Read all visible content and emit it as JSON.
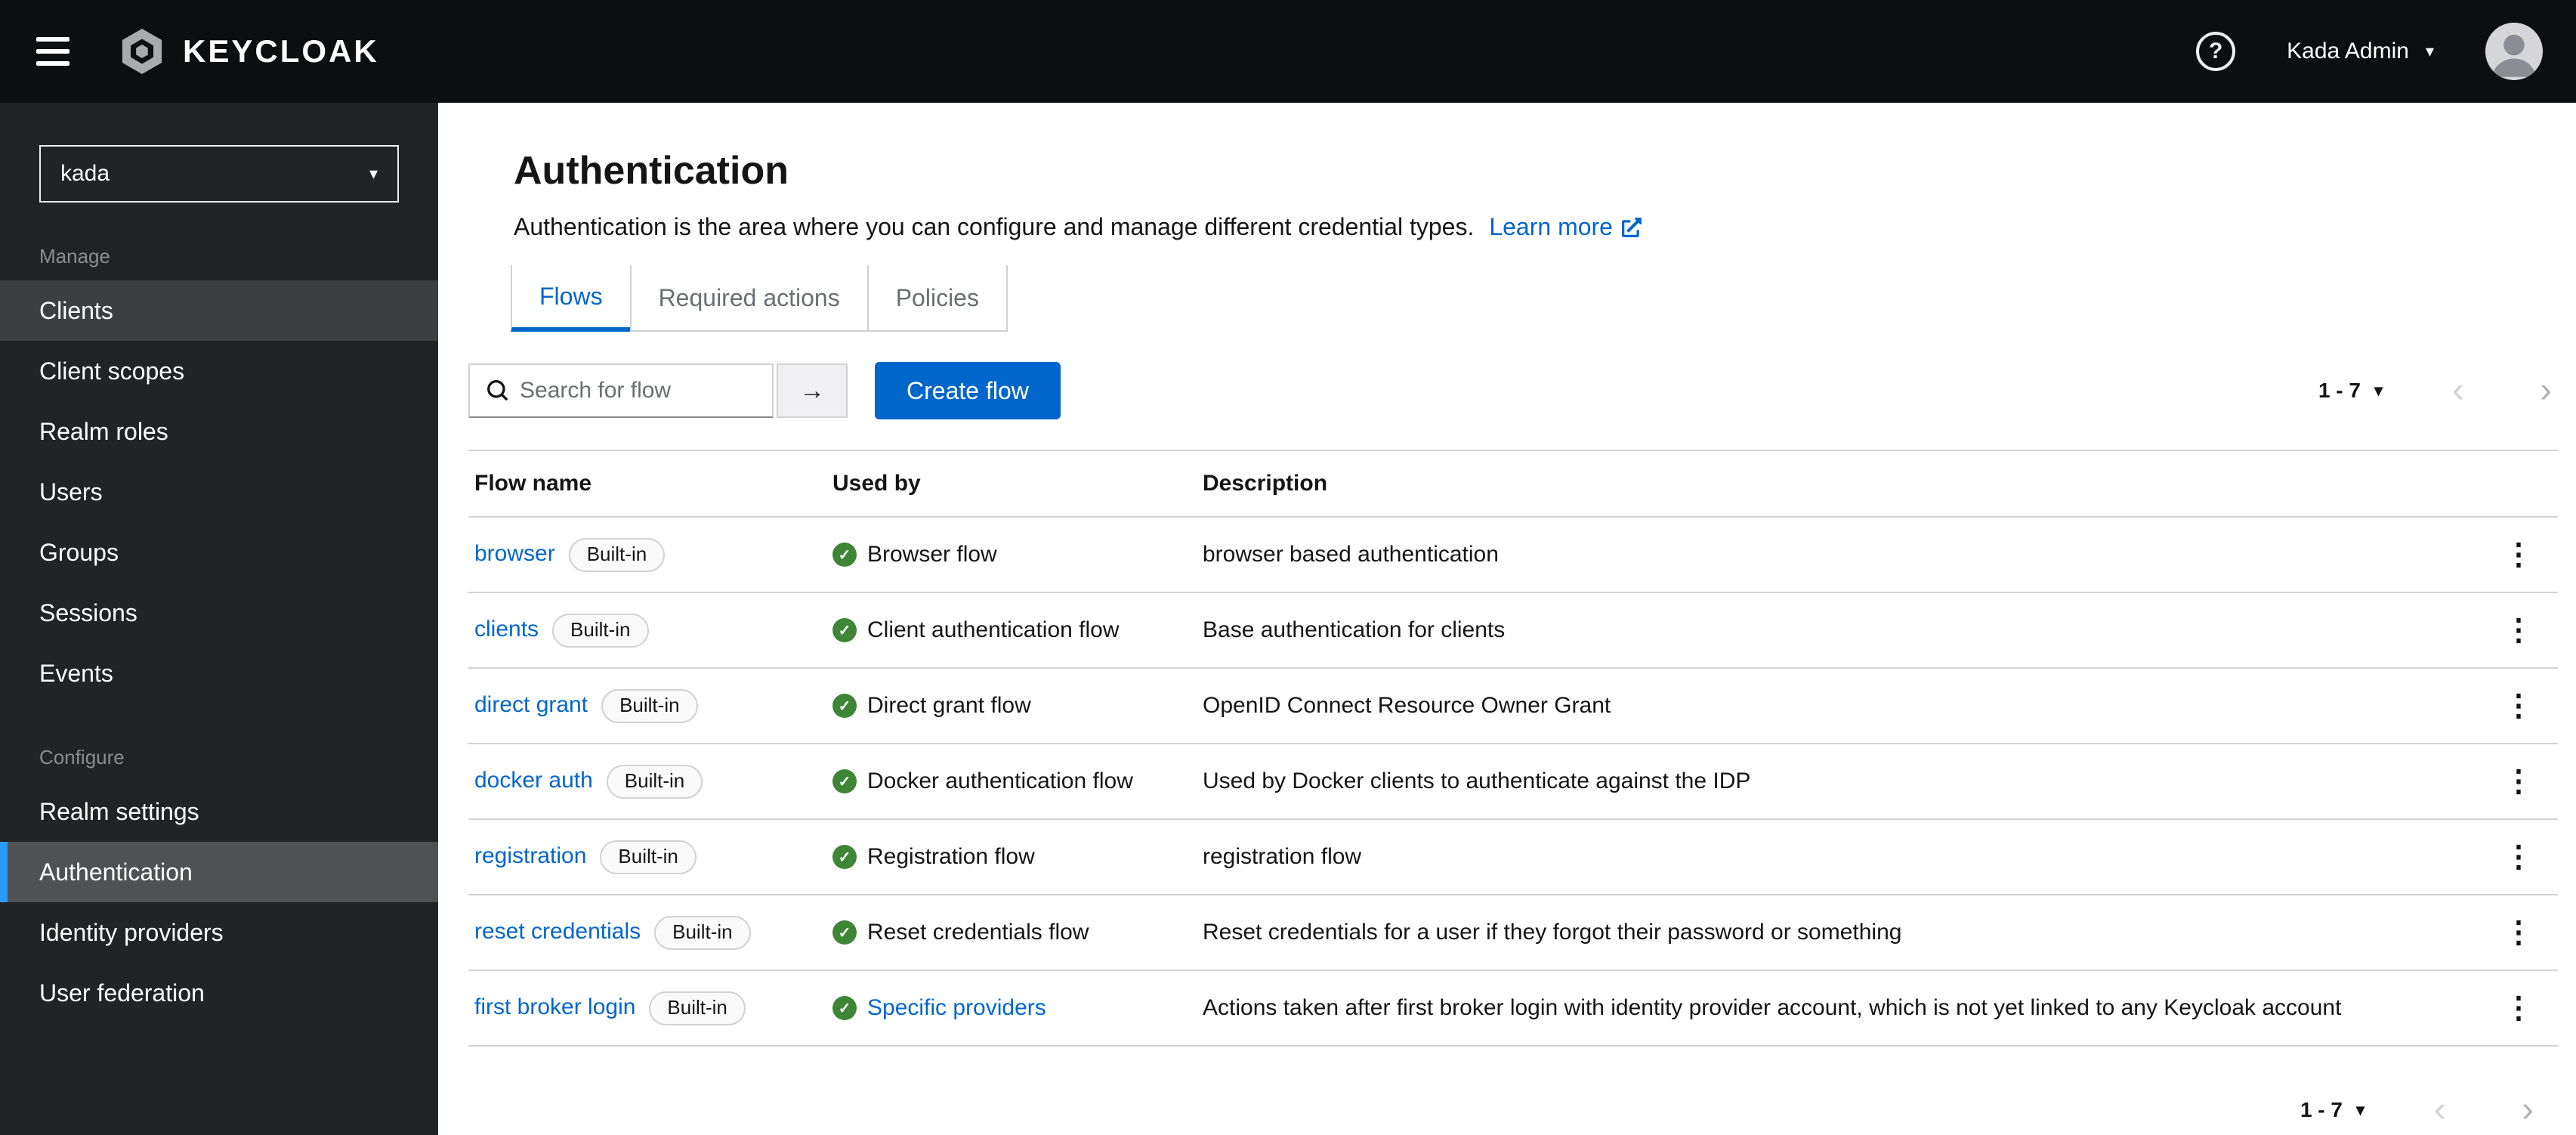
{
  "colors": {
    "primary": "#0066cc",
    "success_green": "#3e8635",
    "nav_active_indicator": "#2b9af3",
    "masthead_bg": "#0d0e10",
    "sidebar_bg": "#212427"
  },
  "icons": {
    "check": "✓",
    "kebab": "⋮",
    "caret_down": "▾",
    "chevron_left": "‹",
    "chevron_right": "›",
    "arrow_right": "→",
    "question": "?"
  },
  "header": {
    "brand": "KEYCLOAK",
    "user": "Kada Admin"
  },
  "sidebar": {
    "realm": "kada",
    "active_item": "Authentication",
    "hovered_item": "Clients",
    "sections": [
      {
        "label": "Manage",
        "items": [
          "Clients",
          "Client scopes",
          "Realm roles",
          "Users",
          "Groups",
          "Sessions",
          "Events"
        ]
      },
      {
        "label": "Configure",
        "items": [
          "Realm settings",
          "Authentication",
          "Identity providers",
          "User federation"
        ]
      }
    ]
  },
  "page": {
    "title": "Authentication",
    "description": "Authentication is the area where you can configure and manage different credential types.",
    "learn_more": "Learn more",
    "tabs": [
      "Flows",
      "Required actions",
      "Policies"
    ],
    "active_tab": "Flows"
  },
  "toolbar": {
    "search_placeholder": "Search for flow",
    "create_button": "Create flow"
  },
  "pagination": {
    "range": "1 - 7"
  },
  "table": {
    "columns": [
      "Flow name",
      "Used by",
      "Description"
    ],
    "rows": [
      {
        "name": "browser",
        "badge": "Built-in",
        "used_by": "Browser flow",
        "used_by_is_link": false,
        "description": "browser based authentication"
      },
      {
        "name": "clients",
        "badge": "Built-in",
        "used_by": "Client authentication flow",
        "used_by_is_link": false,
        "description": "Base authentication for clients"
      },
      {
        "name": "direct grant",
        "badge": "Built-in",
        "used_by": "Direct grant flow",
        "used_by_is_link": false,
        "description": "OpenID Connect Resource Owner Grant"
      },
      {
        "name": "docker auth",
        "badge": "Built-in",
        "used_by": "Docker authentication flow",
        "used_by_is_link": false,
        "description": "Used by Docker clients to authenticate against the IDP"
      },
      {
        "name": "registration",
        "badge": "Built-in",
        "used_by": "Registration flow",
        "used_by_is_link": false,
        "description": "registration flow"
      },
      {
        "name": "reset credentials",
        "badge": "Built-in",
        "used_by": "Reset credentials flow",
        "used_by_is_link": false,
        "description": "Reset credentials for a user if they forgot their password or something"
      },
      {
        "name": "first broker login",
        "badge": "Built-in",
        "used_by": "Specific providers",
        "used_by_is_link": true,
        "description": "Actions taken after first broker login with identity provider account, which is not yet linked to any Keycloak account"
      }
    ]
  }
}
